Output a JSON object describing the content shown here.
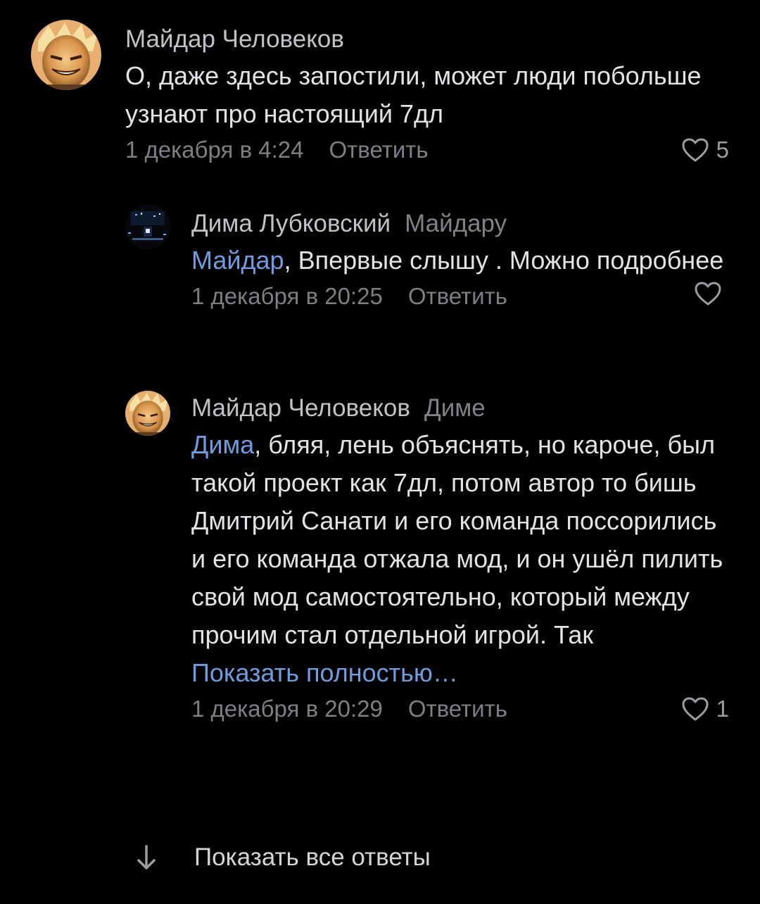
{
  "comments": [
    {
      "author": "Майдар Человеков",
      "reply_to": "",
      "mention": "",
      "text": "О, даже здесь запостили, может люди побольше узнают про настоящий 7дл",
      "show_more": "",
      "time": "1 декабря в 4:24",
      "reply_label": "Ответить",
      "likes": "5"
    },
    {
      "author": "Дима Лубковский",
      "reply_to": "Майдару",
      "mention": "Майдар",
      "text": ", Впервые слышу . Можно подробнее",
      "show_more": "",
      "time": "1 декабря в 20:25",
      "reply_label": "Ответить",
      "likes": ""
    },
    {
      "author": "Майдар Человеков",
      "reply_to": "Диме",
      "mention": "Дима",
      "text": ", бляя, лень объяснять, но кароче, был такой проект как 7дл, потом автор то бишь Дмитрий Санати и его команда поссорились и его команда отжала мод, и он ушёл пилить свой мод самостоятельно, который между прочим стал отдельной игрой. Так",
      "show_more": "Показать полностью…",
      "time": "1 декабря в 20:29",
      "reply_label": "Ответить",
      "likes": "1"
    }
  ],
  "show_all_replies": "Показать все ответы",
  "icons": {
    "like": "heart-outline-icon",
    "show_all": "arrow-down-icon"
  },
  "colors": {
    "background": "#000000",
    "mention": "#6d9de0",
    "secondary": "#7c7f84"
  }
}
